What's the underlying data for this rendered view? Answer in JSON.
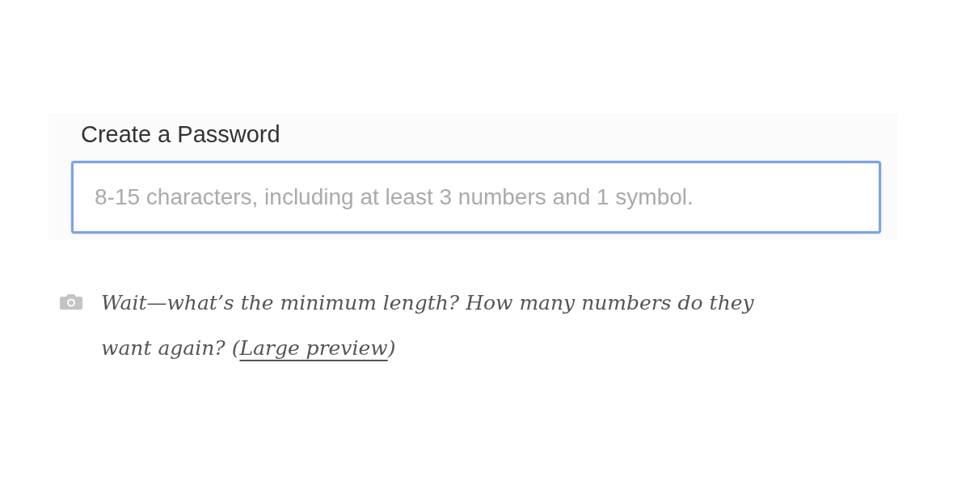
{
  "form_screenshot": {
    "label": "Create a Password",
    "password_field": {
      "placeholder": "8-15 characters, including at least 3 numbers and 1 symbol.",
      "focused": true
    }
  },
  "caption": {
    "text_before": "Wait—what’s the minimum length? How many numbers do they want again? (",
    "link": "Large preview",
    "text_after": ")"
  }
}
